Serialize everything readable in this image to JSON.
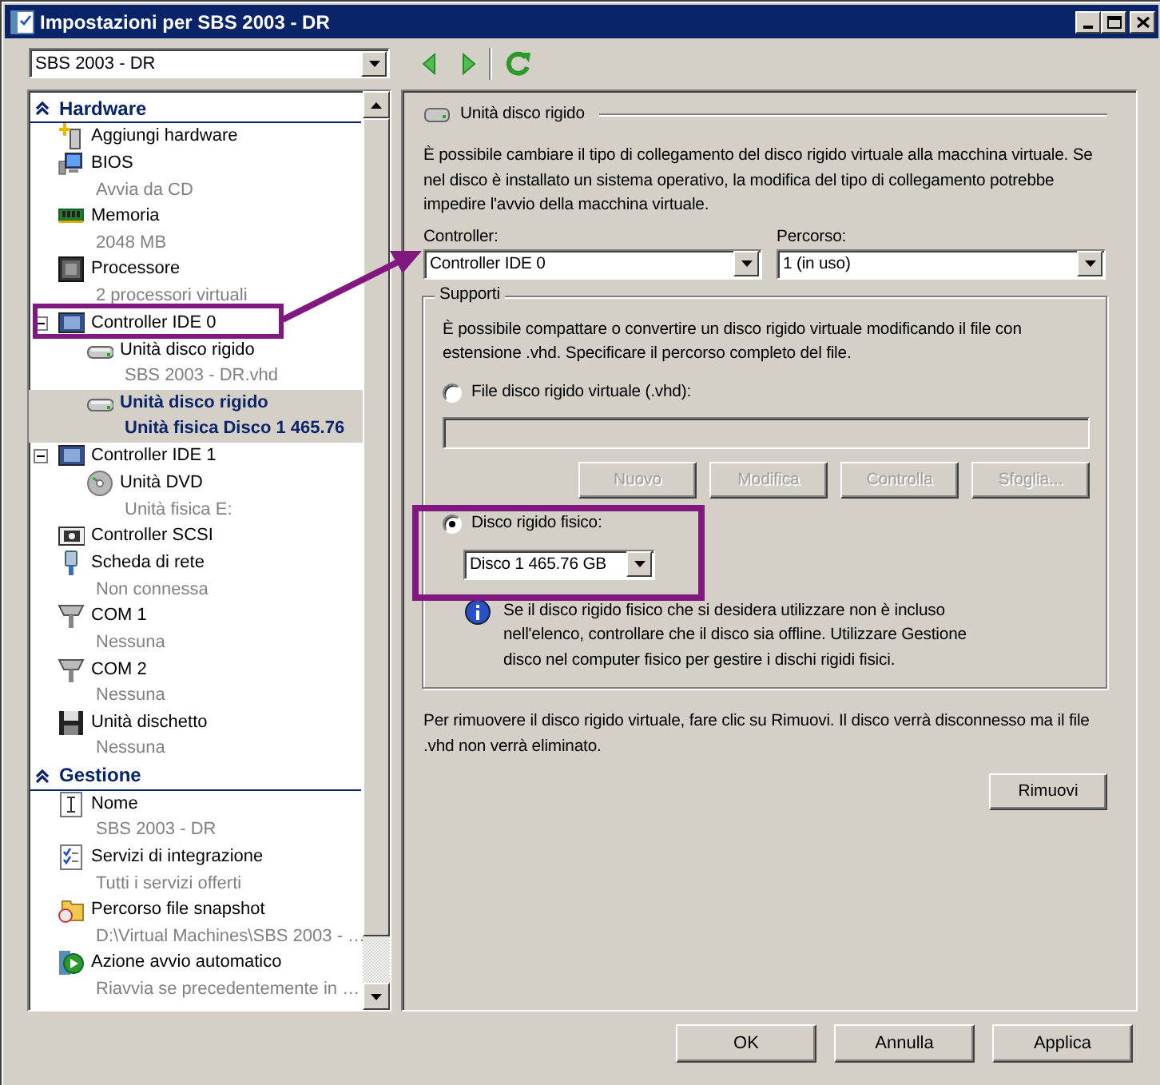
{
  "window": {
    "title": "Impostazioni per SBS 2003 - DR"
  },
  "toolbar": {
    "vm_select": "SBS 2003 - DR"
  },
  "sidebar": {
    "sections": [
      {
        "title": "Hardware",
        "expanded": true,
        "items": [
          {
            "kind": "add",
            "label": "Aggiungi hardware",
            "selected": false
          },
          {
            "kind": "bios",
            "label": "BIOS",
            "detail": "Avvia da CD",
            "selected": false
          },
          {
            "kind": "memory",
            "label": "Memoria",
            "detail": "2048 MB",
            "selected": false
          },
          {
            "kind": "cpu",
            "label": "Processore",
            "detail": "2 processori virtuali",
            "selected": false
          },
          {
            "kind": "controller",
            "label": "Controller IDE 0",
            "selected": false,
            "expanded": true,
            "children": [
              {
                "kind": "drive",
                "label": "Unità disco rigido",
                "detail": "SBS 2003 - DR.vhd",
                "selected": false
              },
              {
                "kind": "drive",
                "label": "Unità disco rigido",
                "detail": "Unità fisica Disco 1 465.76",
                "selected": true
              }
            ]
          },
          {
            "kind": "controller",
            "label": "Controller IDE 1",
            "selected": false,
            "expanded": true,
            "children": [
              {
                "kind": "dvd",
                "label": "Unità DVD",
                "detail": "Unità fisica E:",
                "selected": false
              }
            ]
          },
          {
            "kind": "scsi",
            "label": "Controller SCSI",
            "selected": false
          },
          {
            "kind": "network",
            "label": "Scheda di rete",
            "detail": "Non connessa",
            "selected": false
          },
          {
            "kind": "com",
            "label": "COM 1",
            "detail": "Nessuna",
            "selected": false
          },
          {
            "kind": "com",
            "label": "COM 2",
            "detail": "Nessuna",
            "selected": false
          },
          {
            "kind": "floppy",
            "label": "Unità dischetto",
            "detail": "Nessuna",
            "selected": false
          }
        ]
      },
      {
        "title": "Gestione",
        "expanded": true,
        "items": [
          {
            "kind": "name",
            "label": "Nome",
            "detail": "SBS 2003 - DR",
            "selected": false
          },
          {
            "kind": "services",
            "label": "Servizi di integrazione",
            "detail": "Tutti i servizi offerti",
            "selected": false
          },
          {
            "kind": "folder",
            "label": "Percorso file snapshot",
            "detail": "D:\\Virtual Machines\\SBS 2003 - …",
            "selected": false
          },
          {
            "kind": "autostart",
            "label": "Azione avvio automatico",
            "detail": "Riavvia se precedentemente in …",
            "selected": false
          }
        ]
      }
    ]
  },
  "details": {
    "heading": "Unità disco rigido",
    "intro": "È possibile cambiare il tipo di collegamento del disco rigido virtuale alla macchina virtuale. Se nel disco è installato un sistema operativo, la modifica del tipo di collegamento potrebbe impedire l'avvio della macchina virtuale.",
    "controller": {
      "label": "Controller:",
      "value": "Controller IDE 0"
    },
    "location": {
      "label": "Percorso:",
      "value": "1 (in uso)"
    },
    "media": {
      "title": "Supporti",
      "description": "È possibile compattare o convertire un disco rigido virtuale modificando il file con estensione .vhd. Specificare il percorso completo del file.",
      "options": [
        {
          "kind": "vhd",
          "label": "File disco rigido virtuale (.vhd):",
          "selected": false,
          "path_disabled": true,
          "buttons": [
            {
              "label": "Nuovo",
              "disabled": true
            },
            {
              "label": "Modifica",
              "disabled": true
            },
            {
              "label": "Controlla",
              "disabled": true
            },
            {
              "label": "Sfoglia...",
              "disabled": true
            }
          ]
        },
        {
          "kind": "physical",
          "label": "Disco rigido fisico:",
          "selected": true,
          "value": "Disco 1 465.76 GB",
          "info": "Se il disco rigido fisico che si desidera utilizzare non è incluso nell'elenco, controllare che il disco sia offline. Utilizzare Gestione disco nel computer fisico per gestire i dischi rigidi fisici."
        }
      ]
    },
    "remove_note": "Per rimuovere il disco rigido virtuale, fare clic su Rimuovi. Il disco verrà disconnesso ma il file .vhd non verrà eliminato.",
    "remove_button": "Rimuovi"
  },
  "buttons": [
    "OK",
    "Annulla",
    "Applica"
  ]
}
